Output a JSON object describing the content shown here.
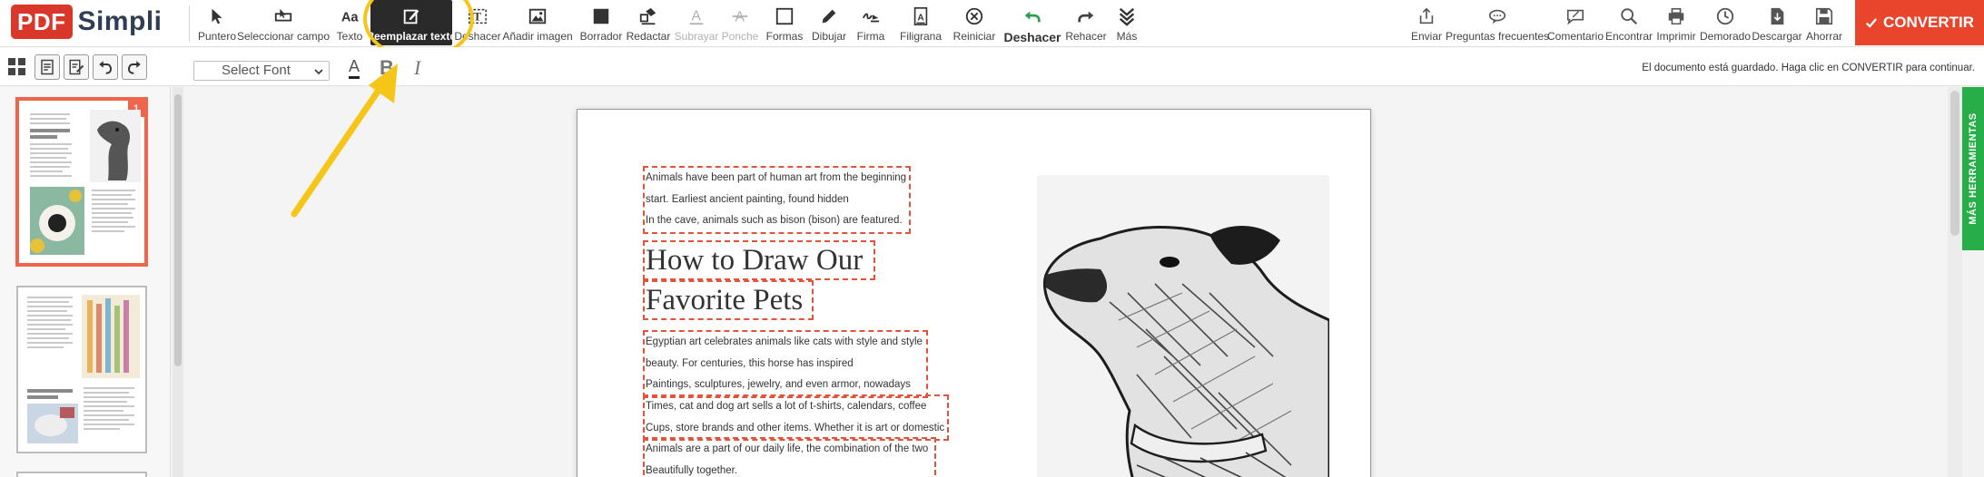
{
  "app": {
    "logo_pdf": "PDF",
    "logo_simpli": "Simpli"
  },
  "colors": {
    "accent": "#e8452c",
    "brand_red": "#d9372a",
    "highlight": "#f5c518",
    "tab_green": "#27ae48",
    "dashed": "#e0543c"
  },
  "toolbar": {
    "tools": [
      {
        "label": "Puntero",
        "icon": "pointer-icon"
      },
      {
        "label": "Seleccionar campo",
        "icon": "select-field-icon"
      },
      {
        "label": "Texto",
        "icon": "text-icon"
      },
      {
        "label": "Reemplazar texto",
        "icon": "replace-text-icon"
      },
      {
        "label": "Deshacer",
        "icon": "text-field-icon"
      },
      {
        "label": "Añadir imagen",
        "icon": "image-icon"
      },
      {
        "label": "Borrador",
        "icon": "eraser-icon"
      },
      {
        "label": "Redactar",
        "icon": "redact-icon"
      },
      {
        "label": "Subrayar",
        "icon": "underline-icon"
      },
      {
        "label": "Ponche",
        "icon": "strikethrough-icon"
      },
      {
        "label": "Formas",
        "icon": "shapes-icon"
      },
      {
        "label": "Dibujar",
        "icon": "pen-icon"
      },
      {
        "label": "Firma",
        "icon": "signature-icon"
      },
      {
        "label": "Filigrana",
        "icon": "watermark-icon"
      },
      {
        "label": "Reiniciar",
        "icon": "reset-icon"
      },
      {
        "label": "Deshacer",
        "icon": "undo-icon"
      },
      {
        "label": "Rehacer",
        "icon": "redo-icon"
      },
      {
        "label": "Más",
        "icon": "more-icon"
      }
    ],
    "right_tools": [
      {
        "label": "Enviar",
        "icon": "share-icon"
      },
      {
        "label": "Preguntas frecuentes",
        "icon": "faq-icon"
      },
      {
        "label": "Comentario",
        "icon": "comment-icon"
      },
      {
        "label": "Encontrar",
        "icon": "search-icon"
      },
      {
        "label": "Imprimir",
        "icon": "print-icon"
      },
      {
        "label": "Demorado",
        "icon": "clock-icon"
      },
      {
        "label": "Descargar",
        "icon": "download-icon"
      },
      {
        "label": "Ahorrar",
        "icon": "save-icon"
      }
    ],
    "convert_label": "CONVERTIR"
  },
  "subbar": {
    "font_select": "Select Font",
    "format_a": "A",
    "format_b": "B",
    "format_i": "I",
    "status": "El documento está guardado. Haga clic en CONVERTIR para continuar."
  },
  "thumbnails": {
    "page1_badge": "1"
  },
  "document": {
    "block1": [
      "Animals have been part of human art from the beginning",
      "start. Earliest ancient painting, found hidden",
      "In the cave, animals such as bison (bison) are featured."
    ],
    "title": [
      "How to Draw Our",
      "Favorite Pets"
    ],
    "block2": [
      "Egyptian art celebrates animals like cats with style and style",
      "beauty. For centuries, this horse has inspired",
      "Paintings, sculptures, jewelry, and even armor, nowadays"
    ],
    "block3": [
      "Times, cat and dog art sells a lot of t-shirts, calendars, coffee",
      "Cups, store brands and other items. Whether it is art or domestic"
    ],
    "block4": [
      "Animals are a part of our daily life, the combination of the two",
      "Beautifully together."
    ]
  },
  "side_tab": "MÁS HERRAMIENTAS"
}
